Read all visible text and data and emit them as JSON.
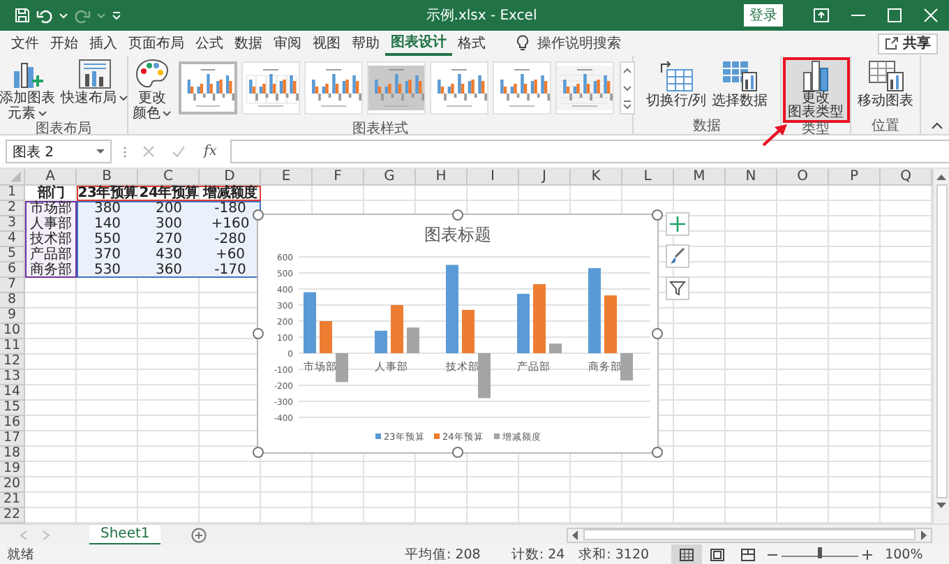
{
  "window": {
    "title": "示例.xlsx - Excel",
    "sign_in": "登录",
    "redo_disabled": true
  },
  "menu_tabs": [
    {
      "label": "文件",
      "selected": false
    },
    {
      "label": "开始",
      "selected": false
    },
    {
      "label": "插入",
      "selected": false
    },
    {
      "label": "页面布局",
      "selected": false
    },
    {
      "label": "公式",
      "selected": false
    },
    {
      "label": "数据",
      "selected": false
    },
    {
      "label": "审阅",
      "selected": false
    },
    {
      "label": "视图",
      "selected": false
    },
    {
      "label": "帮助",
      "selected": false
    },
    {
      "label": "图表设计",
      "selected": true
    },
    {
      "label": "格式",
      "selected": false
    }
  ],
  "tell_me": "操作说明搜索",
  "share": "共享",
  "ribbon_groups": [
    {
      "label": "图表布局",
      "buttons": [
        {
          "kind": "add-element",
          "lines": [
            "添加图表",
            "元素"
          ],
          "dropdown": true,
          "highlighted": false
        },
        {
          "kind": "quick-layout",
          "lines": [
            "快速布局"
          ],
          "dropdown": true,
          "highlighted": false
        }
      ]
    },
    {
      "label": "图表样式",
      "buttons": [
        {
          "kind": "colors",
          "lines": [
            "更改",
            "颜色"
          ],
          "dropdown": true,
          "highlighted": false
        }
      ],
      "gallery": [
        {
          "kind": "plain",
          "selected": true
        },
        {
          "kind": "columns",
          "selected": false
        },
        {
          "kind": "plain",
          "selected": false
        },
        {
          "kind": "dark",
          "selected": false
        },
        {
          "kind": "plain",
          "selected": false
        },
        {
          "kind": "plain",
          "selected": false
        },
        {
          "kind": "patterned",
          "selected": false
        }
      ]
    },
    {
      "label": "数据",
      "buttons": [
        {
          "kind": "switch",
          "lines": [
            "切换行/列"
          ],
          "dropdown": false,
          "highlighted": false
        },
        {
          "kind": "select-data",
          "lines": [
            "选择数据"
          ],
          "dropdown": false,
          "highlighted": false
        }
      ]
    },
    {
      "label": "类型",
      "buttons": [
        {
          "kind": "chart-type",
          "lines": [
            "更改",
            "图表类型"
          ],
          "dropdown": false,
          "highlighted": true
        }
      ]
    },
    {
      "label": "位置",
      "buttons": [
        {
          "kind": "move",
          "lines": [
            "移动图表"
          ],
          "dropdown": false,
          "highlighted": false
        }
      ]
    }
  ],
  "formula_bar": {
    "name_box": "图表 2",
    "fx": "fx"
  },
  "sheet": {
    "columns": [
      "A",
      "B",
      "C",
      "D",
      "E",
      "F",
      "G",
      "H",
      "I",
      "J",
      "K",
      "L",
      "M",
      "N",
      "O",
      "P",
      "Q"
    ],
    "rows": [
      "1",
      "2",
      "3",
      "4",
      "5",
      "6",
      "7",
      "8",
      "9",
      "10",
      "11",
      "12",
      "13",
      "14",
      "15",
      "16",
      "17",
      "18",
      "19",
      "20",
      "21",
      "22"
    ],
    "cells": [
      [
        {
          "text": "部门",
          "bold": true,
          "kind": "plain"
        },
        {
          "text": "23年预算",
          "bold": true,
          "kind": "series"
        },
        {
          "text": "24年预算",
          "bold": true,
          "kind": "series"
        },
        {
          "text": "增减额度",
          "bold": true,
          "kind": "series"
        }
      ],
      [
        {
          "text": "市场部",
          "bold": false,
          "kind": "category"
        },
        {
          "text": "380",
          "bold": false,
          "kind": "value"
        },
        {
          "text": "200",
          "bold": false,
          "kind": "value"
        },
        {
          "text": "-180",
          "bold": false,
          "kind": "value"
        }
      ],
      [
        {
          "text": "人事部",
          "bold": false,
          "kind": "category"
        },
        {
          "text": "140",
          "bold": false,
          "kind": "value"
        },
        {
          "text": "300",
          "bold": false,
          "kind": "value"
        },
        {
          "text": "+160",
          "bold": false,
          "kind": "value"
        }
      ],
      [
        {
          "text": "技术部",
          "bold": false,
          "kind": "category"
        },
        {
          "text": "550",
          "bold": false,
          "kind": "value"
        },
        {
          "text": "270",
          "bold": false,
          "kind": "value"
        },
        {
          "text": "-280",
          "bold": false,
          "kind": "value"
        }
      ],
      [
        {
          "text": "产品部",
          "bold": false,
          "kind": "category"
        },
        {
          "text": "370",
          "bold": false,
          "kind": "value"
        },
        {
          "text": "430",
          "bold": false,
          "kind": "value"
        },
        {
          "text": "+60",
          "bold": false,
          "kind": "value"
        }
      ],
      [
        {
          "text": "商务部",
          "bold": false,
          "kind": "category"
        },
        {
          "text": "530",
          "bold": false,
          "kind": "value"
        },
        {
          "text": "360",
          "bold": false,
          "kind": "value"
        },
        {
          "text": "-170",
          "bold": false,
          "kind": "value"
        }
      ]
    ]
  },
  "chart": {
    "selected": true,
    "chart_data": {
      "type": "bar",
      "title": "图表标题",
      "categories": [
        "市场部",
        "人事部",
        "技术部",
        "产品部",
        "商务部"
      ],
      "series": [
        {
          "name": "23年预算",
          "color": "#5b9bd5",
          "values": [
            380,
            140,
            550,
            370,
            530
          ]
        },
        {
          "name": "24年预算",
          "color": "#ed7d31",
          "values": [
            200,
            300,
            270,
            430,
            360
          ]
        },
        {
          "name": "增减额度",
          "color": "#a5a5a5",
          "values": [
            -180,
            160,
            -280,
            60,
            -170
          ]
        }
      ],
      "ylim": [
        -400,
        600
      ],
      "yticks": [
        -400,
        -300,
        -200,
        -100,
        0,
        100,
        200,
        300,
        400,
        500,
        600
      ],
      "grid": true,
      "legend": true
    }
  },
  "sheet_tabs": [
    {
      "label": "Sheet1",
      "selected": true
    }
  ],
  "status_bar": {
    "ready": "就绪",
    "average": "平均值: 208",
    "count": "计数: 24",
    "sum": "求和: 3120",
    "views": [
      {
        "kind": "normal",
        "selected": true
      },
      {
        "kind": "page-layout",
        "selected": false
      },
      {
        "kind": "page-break",
        "selected": false
      }
    ],
    "zoom": {
      "level": 0.5
    },
    "zoom_text": "100%"
  }
}
